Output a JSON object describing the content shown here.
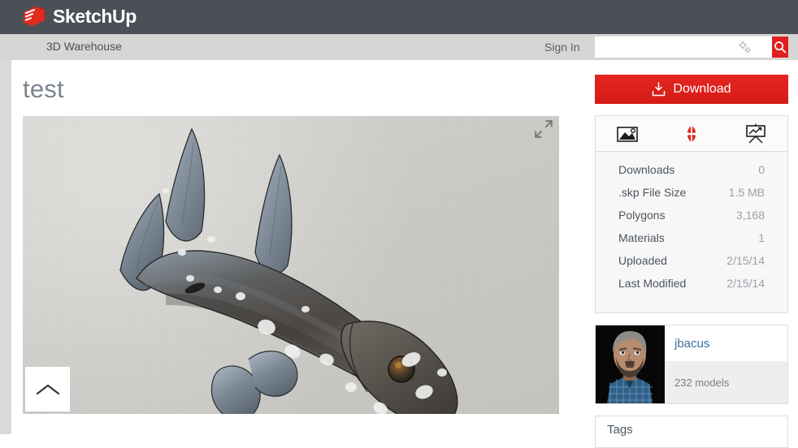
{
  "brand": {
    "name": "SketchUp",
    "logo_icon": "sketchup-logo-icon",
    "bar_color": "#4b4f58"
  },
  "nav": {
    "site_label": "3D Warehouse",
    "signin_label": "Sign In",
    "search": {
      "value": "",
      "placeholder": "",
      "advanced_icon": "gears-icon",
      "submit_icon": "search-icon",
      "submit_color": "#e02020"
    },
    "bar_color": "#d6d6d4"
  },
  "model": {
    "title": "test",
    "viewer": {
      "expand_icon": "expand-arrows-icon",
      "collapse_icon": "chevron-up-icon",
      "background_color": "#cfcdc9",
      "subject": "coelacanth-fish-3d-model"
    }
  },
  "rail": {
    "download": {
      "label": "Download",
      "icon": "download-tray-icon",
      "color": "#e52421"
    },
    "tabs": [
      {
        "name": "images-tab",
        "icon": "image-icon",
        "active": false
      },
      {
        "name": "3d-view-tab",
        "icon": "orbit-3d-icon",
        "active": true
      },
      {
        "name": "stats-tab",
        "icon": "presentation-chart-icon",
        "active": false
      }
    ],
    "stats": [
      {
        "label": "Downloads",
        "value": "0"
      },
      {
        "label": ".skp File Size",
        "value": "1.5 MB"
      },
      {
        "label": "Polygons",
        "value": "3,168"
      },
      {
        "label": "Materials",
        "value": "1"
      },
      {
        "label": "Uploaded",
        "value": "2/15/14"
      },
      {
        "label": "Last Modified",
        "value": "2/15/14"
      }
    ],
    "author": {
      "name": "jbacus",
      "models_count": "232 models",
      "avatar_icon": "user-photo-avatar"
    },
    "tags": {
      "title": "Tags"
    }
  }
}
